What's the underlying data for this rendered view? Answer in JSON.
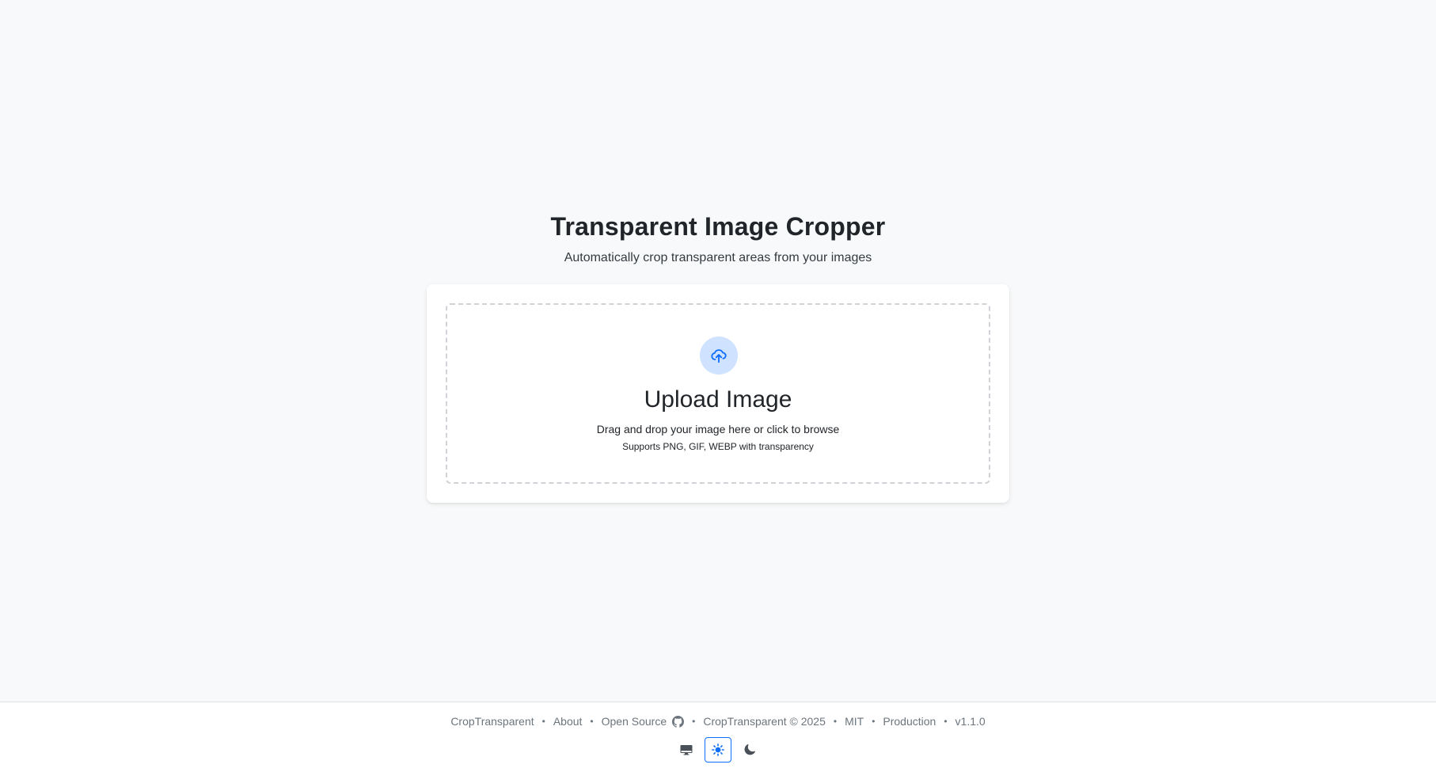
{
  "hero": {
    "title": "Transparent Image Cropper",
    "subtitle": "Automatically crop transparent areas from your images"
  },
  "upload": {
    "icon": "cloud-upload-icon",
    "heading": "Upload Image",
    "description": "Drag and drop your image here or click to browse",
    "formats": "Supports PNG, GIF, WEBP with transparency"
  },
  "footer": {
    "brand": "CropTransparent",
    "about": "About",
    "open_source": "Open Source",
    "copyright": "CropTransparent © 2025",
    "license": "MIT",
    "environment": "Production",
    "version": "v1.1.0",
    "separator": "•"
  },
  "theme": {
    "options": [
      {
        "name": "system",
        "icon": "monitor-icon",
        "active": false
      },
      {
        "name": "light",
        "icon": "sun-icon",
        "active": true
      },
      {
        "name": "dark",
        "icon": "moon-icon",
        "active": false
      }
    ]
  },
  "colors": {
    "accent": "#0d6efd",
    "accent_light": "#cfe2ff",
    "background": "#f8f9fa",
    "muted_text": "#6c757d"
  }
}
